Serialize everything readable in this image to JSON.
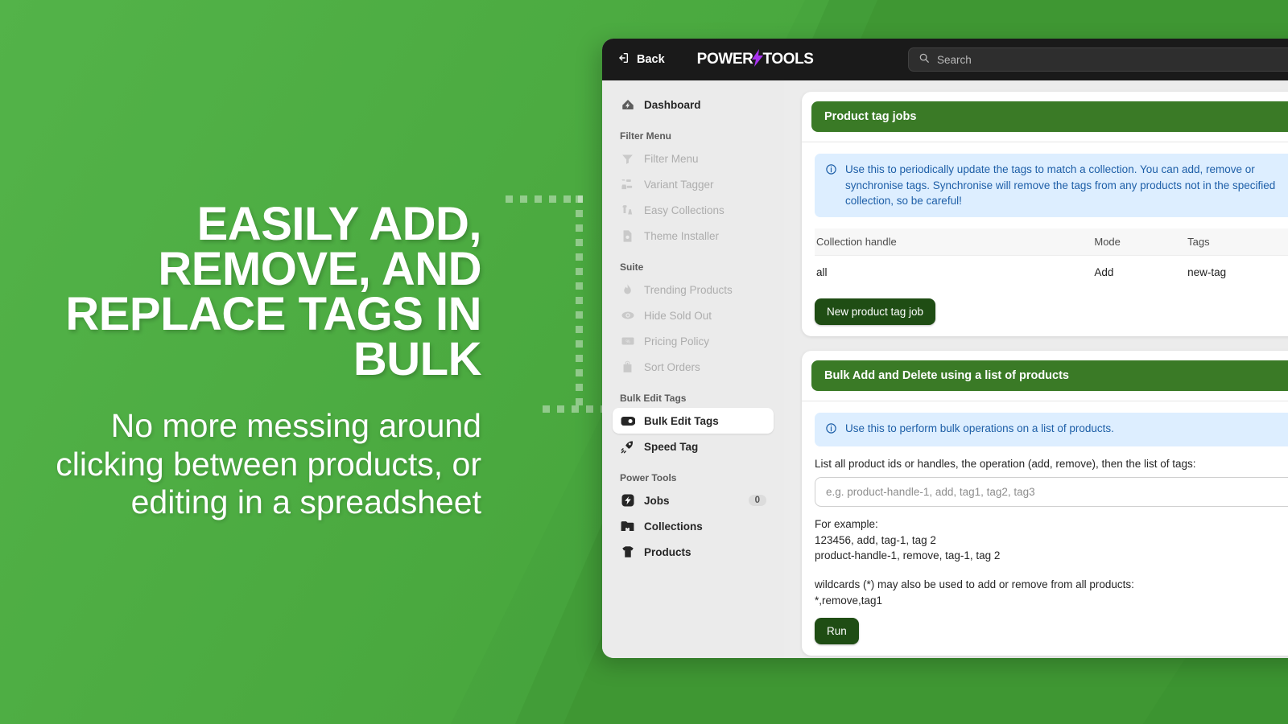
{
  "promo": {
    "headline": "EASILY ADD, REMOVE, AND REPLACE TAGS IN BULK",
    "subheading": "No more messing around clicking between products, or editing in a spreadsheet"
  },
  "topbar": {
    "back_label": "Back",
    "logo_left": "POWER",
    "logo_bolt": "⚡",
    "logo_right": "TOOLS",
    "search_placeholder": "Search",
    "search_value": ""
  },
  "sidebar": {
    "dashboard": {
      "label": "Dashboard",
      "icon": "dashboard-icon"
    },
    "groups": [
      {
        "title": "Filter Menu",
        "items": [
          {
            "label": "Filter Menu",
            "icon": "funnel-icon",
            "dim": true
          },
          {
            "label": "Variant Tagger",
            "icon": "variant-tagger-icon",
            "dim": true
          },
          {
            "label": "Easy Collections",
            "icon": "easy-collections-icon",
            "dim": true
          },
          {
            "label": "Theme Installer",
            "icon": "theme-installer-icon",
            "dim": true
          }
        ]
      },
      {
        "title": "Suite",
        "items": [
          {
            "label": "Trending Products",
            "icon": "flame-icon",
            "dim": true
          },
          {
            "label": "Hide Sold Out",
            "icon": "eye-off-icon",
            "dim": true
          },
          {
            "label": "Pricing Policy",
            "icon": "money-icon",
            "dim": true
          },
          {
            "label": "Sort Orders",
            "icon": "bag-icon",
            "dim": true
          }
        ]
      },
      {
        "title": "Bulk Edit Tags",
        "items": [
          {
            "label": "Bulk Edit Tags",
            "icon": "tag-fill-icon",
            "dim": false,
            "active": true
          },
          {
            "label": "Speed Tag",
            "icon": "speed-tag-icon",
            "dim": false
          }
        ]
      },
      {
        "title": "Power Tools",
        "items": [
          {
            "label": "Jobs",
            "icon": "jobs-bolt-icon",
            "dim": false,
            "badge": "0"
          },
          {
            "label": "Collections",
            "icon": "collections-icon",
            "dim": false
          },
          {
            "label": "Products",
            "icon": "tshirt-icon",
            "dim": false
          }
        ]
      }
    ]
  },
  "cards": {
    "product_tag_jobs": {
      "title": "Product tag jobs",
      "info": "Use this to periodically update the tags to match a collection. You can add, remove or synchronise tags. Synchronise will remove the tags from any products not in the specified collection, so be careful!",
      "columns": [
        "Collection handle",
        "Mode",
        "Tags"
      ],
      "rows": [
        [
          "all",
          "Add",
          "new-tag"
        ]
      ],
      "button": "New product tag job"
    },
    "bulk_add_delete": {
      "title": "Bulk Add and Delete using a list of products",
      "info": "Use this to perform bulk operations on a list of products.",
      "field_label": "List all product ids or handles, the operation (add, remove), then the list of tags:",
      "field_placeholder": "e.g. product-handle-1, add, tag1, tag2, tag3",
      "field_value": "",
      "example_block_1": "For example:\n123456, add, tag-1, tag 2\nproduct-handle-1, remove, tag-1, tag 2",
      "example_block_2": "wildcards (*) may also be used to add or remove from all products:\n*,remove,tag1",
      "button": "Run"
    }
  },
  "colors": {
    "brand_green": "#4CA943",
    "card_header_green": "#3a7a26",
    "button_green": "#1f4d14",
    "info_blue_bg": "#ddeeff",
    "info_blue_text": "#1e5fa8",
    "bolt_purple": "#a832f0",
    "topbar_black": "#1a1a1a"
  }
}
